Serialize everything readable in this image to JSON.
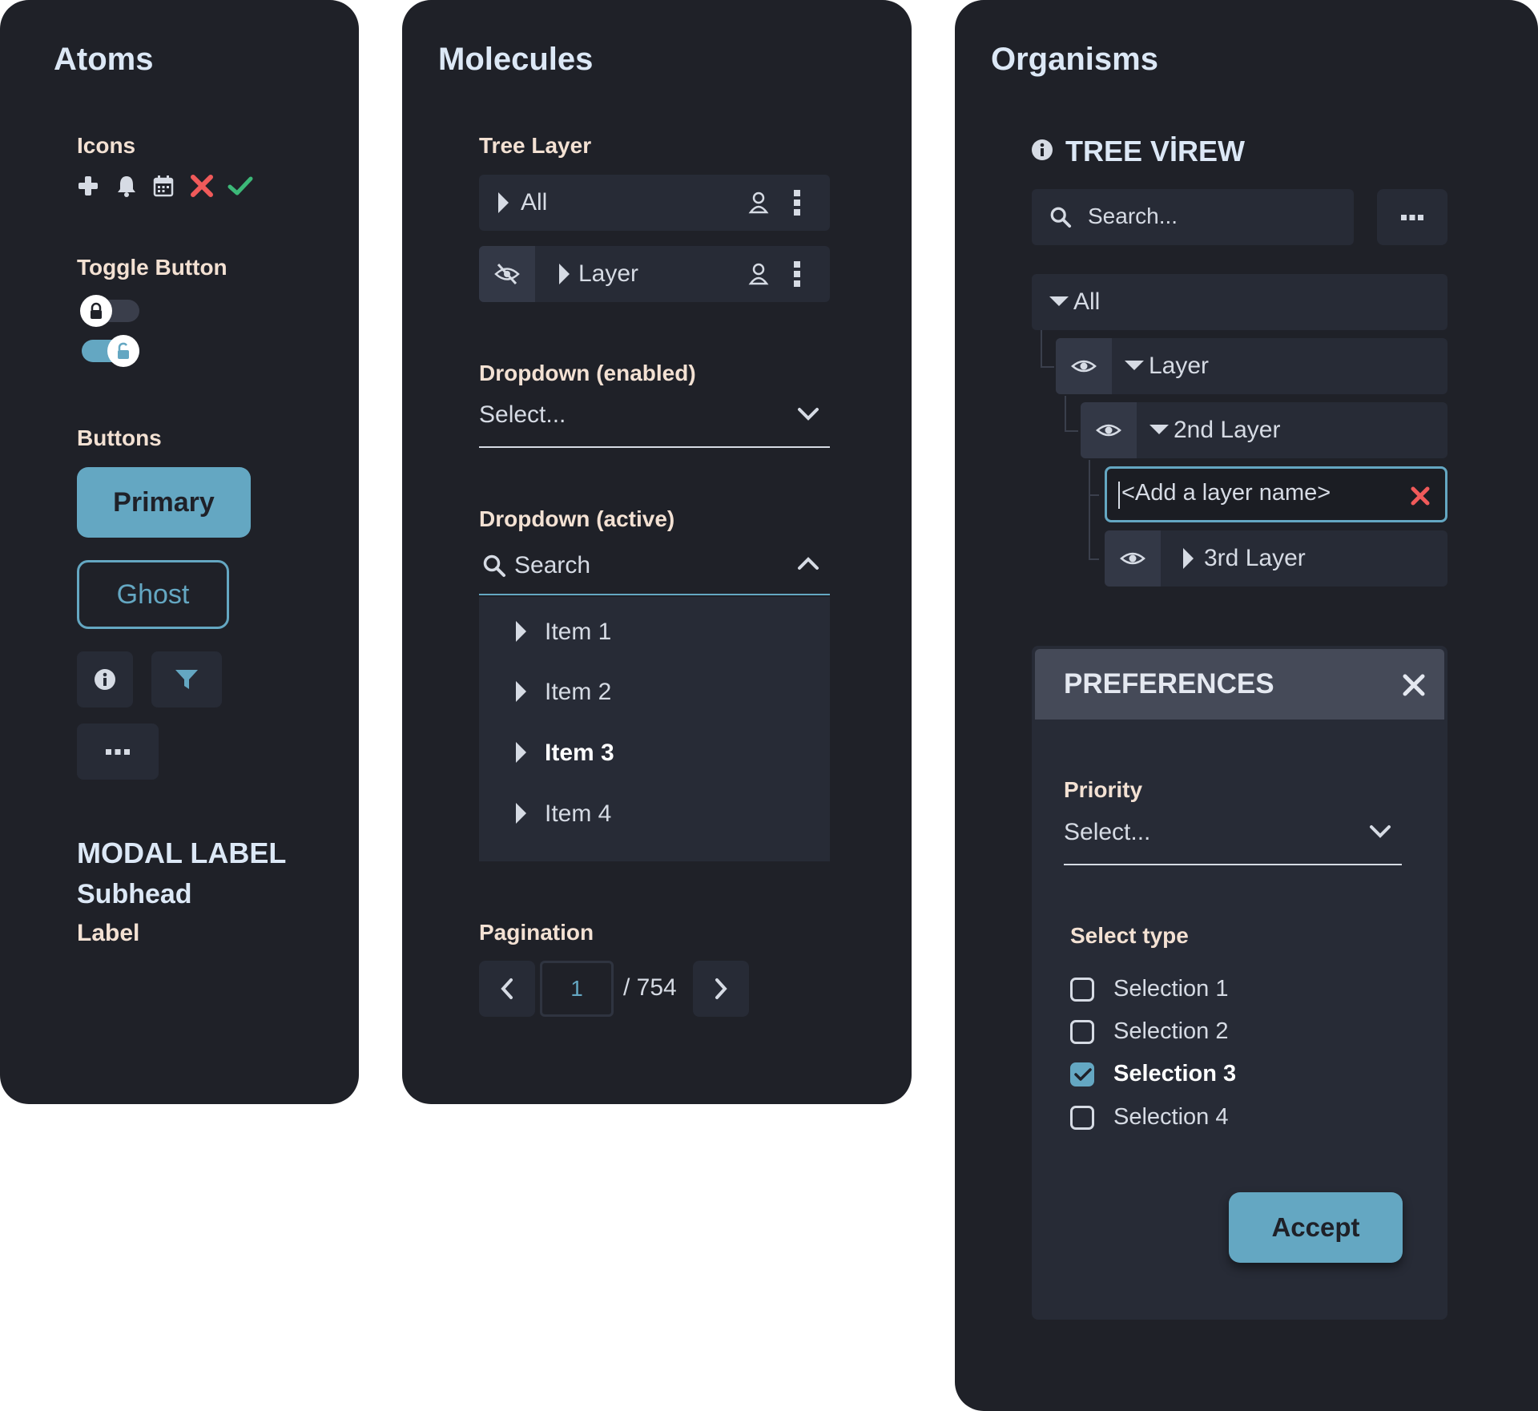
{
  "atoms": {
    "title": "Atoms",
    "icons_label": "Icons",
    "icons": [
      "plus-icon",
      "bell-icon",
      "calendar-icon",
      "x-icon",
      "check-icon"
    ],
    "toggle_label": "Toggle Button",
    "buttons_label": "Buttons",
    "primary_label": "Primary",
    "ghost_label": "Ghost",
    "modal_label": "MODAL LABEL",
    "subhead": "Subhead",
    "label": "Label"
  },
  "molecules": {
    "title": "Molecules",
    "tree_layer_label": "Tree Layer",
    "tree_rows": [
      {
        "label": "All"
      },
      {
        "label": "Layer"
      }
    ],
    "dropdown_enabled_label": "Dropdown (enabled)",
    "dropdown_enabled_placeholder": "Select...",
    "dropdown_active_label": "Dropdown (active)",
    "dropdown_active_placeholder": "Search",
    "items": [
      {
        "label": "Item 1",
        "bold": false
      },
      {
        "label": "Item 2",
        "bold": false
      },
      {
        "label": "Item 3",
        "bold": true
      },
      {
        "label": "Item 4",
        "bold": false
      }
    ],
    "pagination_label": "Pagination",
    "page_current": "1",
    "page_total": "/ 754"
  },
  "organisms": {
    "title": "Organisms",
    "tree_view_title": "TREE VİREW",
    "search_placeholder": "Search...",
    "tree": [
      {
        "label": "All"
      },
      {
        "label": "Layer"
      },
      {
        "label": "2nd Layer"
      },
      {
        "label": "3rd Layer"
      }
    ],
    "layer_name_placeholder": "<Add a layer name>",
    "preferences": {
      "title": "PREFERENCES",
      "priority_label": "Priority",
      "priority_placeholder": "Select...",
      "select_type_label": "Select type",
      "options": [
        {
          "label": "Selection 1",
          "checked": false
        },
        {
          "label": "Selection 2",
          "checked": false
        },
        {
          "label": "Selection 3",
          "checked": true
        },
        {
          "label": "Selection 4",
          "checked": false
        }
      ],
      "accept_label": "Accept"
    }
  },
  "colors": {
    "panel_bg": "#1f2128",
    "row_bg": "#272b36",
    "accent": "#64a7c2",
    "danger": "#f05a5a",
    "success": "#3cb878",
    "heading": "#dce8f6",
    "section": "#f3e1d3"
  }
}
